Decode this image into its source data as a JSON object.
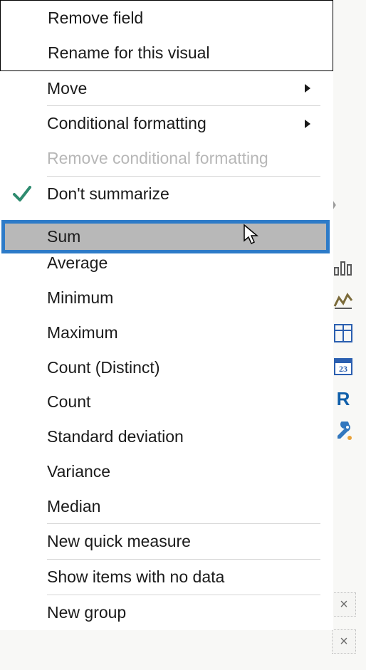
{
  "menu": {
    "items": {
      "remove_field": "Remove field",
      "rename_for_visual": "Rename for this visual",
      "move": "Move",
      "conditional_formatting": "Conditional formatting",
      "remove_conditional_formatting": "Remove conditional formatting",
      "dont_summarize": "Don't summarize",
      "sum": "Sum",
      "average": "Average",
      "minimum": "Minimum",
      "maximum": "Maximum",
      "count_distinct": "Count (Distinct)",
      "count": "Count",
      "standard_deviation": "Standard deviation",
      "variance": "Variance",
      "median": "Median",
      "new_quick_measure": "New quick measure",
      "show_items_no_data": "Show items with no data",
      "new_group": "New group"
    },
    "checked": "dont_summarize",
    "highlighted": "sum"
  },
  "colors": {
    "highlight_border": "#2d7bc8",
    "highlight_fill": "#b8b8b8",
    "check": "#2e8b6f",
    "side_key": "#3277be",
    "side_r": "#0f5faa",
    "side_calendar": "#2b5fb0"
  },
  "side_panel": {
    "r_label": "R",
    "calendar_number": "23"
  },
  "close_glyph": "×"
}
